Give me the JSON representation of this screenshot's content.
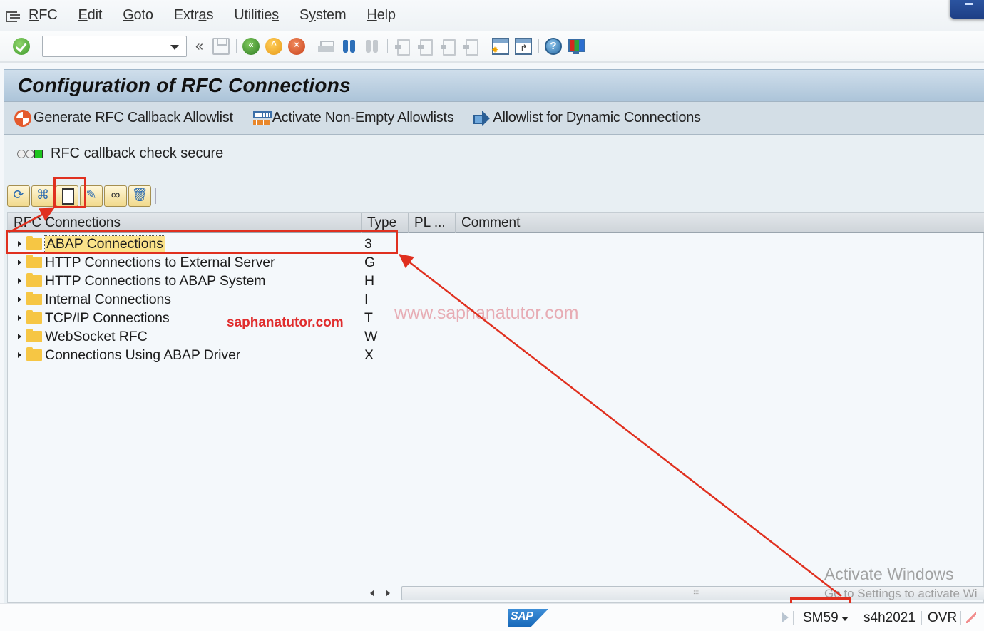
{
  "menubar": {
    "items": [
      {
        "label": "RFC",
        "mnemonic_index": 0
      },
      {
        "label": "Edit",
        "mnemonic_index": 0
      },
      {
        "label": "Goto",
        "mnemonic_index": 0
      },
      {
        "label": "Extras",
        "mnemonic_index": 4
      },
      {
        "label": "Utilities",
        "mnemonic_index": 8
      },
      {
        "label": "System",
        "mnemonic_index": 1
      },
      {
        "label": "Help",
        "mnemonic_index": 0
      }
    ]
  },
  "toolbar": {
    "command_field_value": "",
    "icons": [
      "enter-icon",
      "save-icon",
      "back-icon",
      "exit-icon",
      "cancel-icon",
      "print-icon",
      "find-icon",
      "find-next-icon",
      "first-page-icon",
      "previous-page-icon",
      "next-page-icon",
      "last-page-icon",
      "create-session-icon",
      "create-shortcut-icon",
      "help-icon",
      "customize-layout-icon"
    ]
  },
  "page": {
    "title": "Configuration of RFC Connections"
  },
  "app_toolbar": {
    "buttons": [
      {
        "label": "Generate RFC Callback Allowlist",
        "icon": "generate-icon"
      },
      {
        "label": "Activate Non-Empty Allowlists",
        "icon": "activate-icon"
      },
      {
        "label": "Allowlist for Dynamic Connections",
        "icon": "arrow-right-icon"
      }
    ]
  },
  "status_indicator": {
    "label": "RFC callback check secure",
    "state": "green"
  },
  "tree_toolbar": {
    "buttons": [
      "refresh",
      "find",
      "create",
      "change",
      "display",
      "delete"
    ]
  },
  "grid": {
    "columns": [
      "RFC Connections",
      "Type",
      "PL ...",
      "Comment"
    ],
    "rows": [
      {
        "name": "ABAP Connections",
        "type": "3",
        "selected": true
      },
      {
        "name": "HTTP Connections to External Server",
        "type": "G"
      },
      {
        "name": "HTTP Connections to ABAP System",
        "type": "H"
      },
      {
        "name": "Internal Connections",
        "type": "I"
      },
      {
        "name": "TCP/IP Connections",
        "type": "T"
      },
      {
        "name": "WebSocket RFC",
        "type": "W"
      },
      {
        "name": "Connections Using ABAP Driver",
        "type": "X"
      }
    ]
  },
  "watermarks": {
    "red": "saphanatutor.com",
    "faint": "www.saphanatutor.com",
    "activate_title": "Activate Windows",
    "activate_sub": "Go to Settings to activate Wi"
  },
  "statusbar": {
    "logo": "SAP",
    "transaction": "SM59",
    "system": "s4h2021",
    "mode": "OVR"
  },
  "colors": {
    "annotation": "#e0301f",
    "title_bar": "#acc4d9",
    "selection": "#fbe38a"
  }
}
